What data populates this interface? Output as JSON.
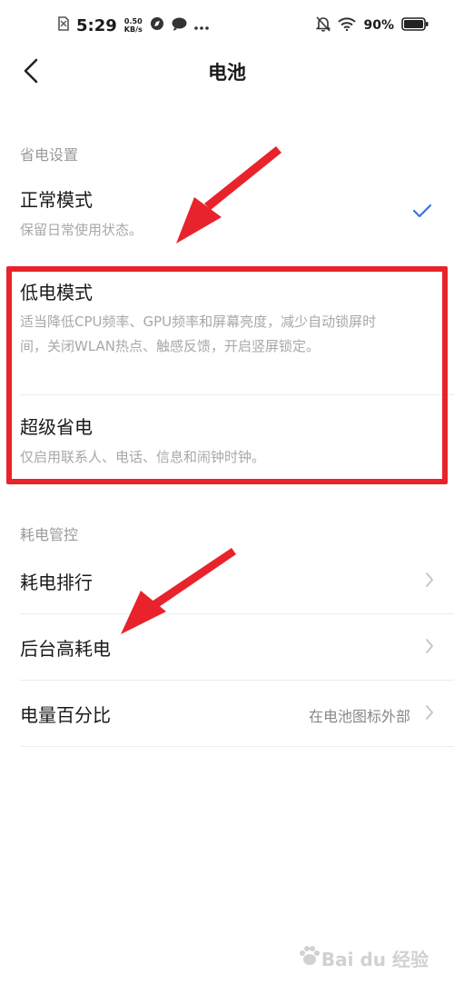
{
  "status_bar": {
    "time": "5:29",
    "speed_value": "0.50",
    "speed_unit": "KB/s",
    "battery_percent": "90%",
    "icons": [
      "sim-off-icon",
      "compass-icon",
      "chat-bubble-icon",
      "more-dots-icon",
      "mute-bell-icon",
      "wifi-icon",
      "battery-icon"
    ]
  },
  "nav": {
    "title": "电池",
    "back_icon": "chevron-left-icon"
  },
  "sections": {
    "power_saving": {
      "header": "省电设置",
      "items": [
        {
          "title": "正常模式",
          "desc": "保留日常使用状态。",
          "selected": true
        },
        {
          "title": "低电模式",
          "desc": "适当降低CPU频率、GPU频率和屏幕亮度，减少自动锁屏时间，关闭WLAN热点、触感反馈，开启竖屏锁定。",
          "selected": false
        },
        {
          "title": "超级省电",
          "desc": "仅启用联系人、电话、信息和闹钟时钟。",
          "selected": false
        }
      ]
    },
    "power_control": {
      "header": "耗电管控",
      "items": [
        {
          "title": "耗电排行",
          "value": ""
        },
        {
          "title": "后台高耗电",
          "value": ""
        },
        {
          "title": "电量百分比",
          "value": "在电池图标外部"
        }
      ]
    }
  },
  "annotation": {
    "highlight_color": "#e8232b"
  },
  "watermark": {
    "text": "Bai du 经验"
  }
}
